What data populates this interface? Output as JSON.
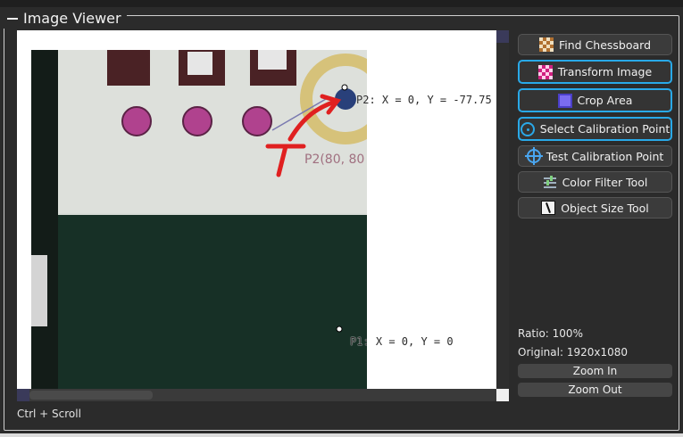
{
  "panel": {
    "title": "Image Viewer",
    "scroll_hint": "Ctrl + Scroll"
  },
  "viewer": {
    "p2_label": "P2: X = 0, Y = -77.75",
    "p1_label": "P1: X = 0, Y = 0",
    "board_text": "P2(80, 80"
  },
  "tools": [
    {
      "label": "Find Chessboard",
      "icon": "chessboard-icon",
      "selected": false
    },
    {
      "label": "Transform Image",
      "icon": "transform-icon",
      "selected": true
    },
    {
      "label": "Crop Area",
      "icon": "crop-icon",
      "selected": true
    },
    {
      "label": "Select Calibration Point",
      "icon": "target-icon",
      "selected": true
    },
    {
      "label": "Test Calibration Point",
      "icon": "crosshair-icon",
      "selected": false
    },
    {
      "label": "Color Filter Tool",
      "icon": "sliders-icon",
      "selected": false
    },
    {
      "label": "Object Size Tool",
      "icon": "ruler-icon",
      "selected": false
    }
  ],
  "info": {
    "ratio": "Ratio: 100%",
    "original": "Original: 1920x1080"
  },
  "zoom": {
    "in_label": "Zoom In",
    "out_label": "Zoom Out"
  },
  "colors": {
    "accent": "#29a9e8",
    "panel_bg": "#2b2b2b",
    "button_bg": "#3b3b3b"
  }
}
